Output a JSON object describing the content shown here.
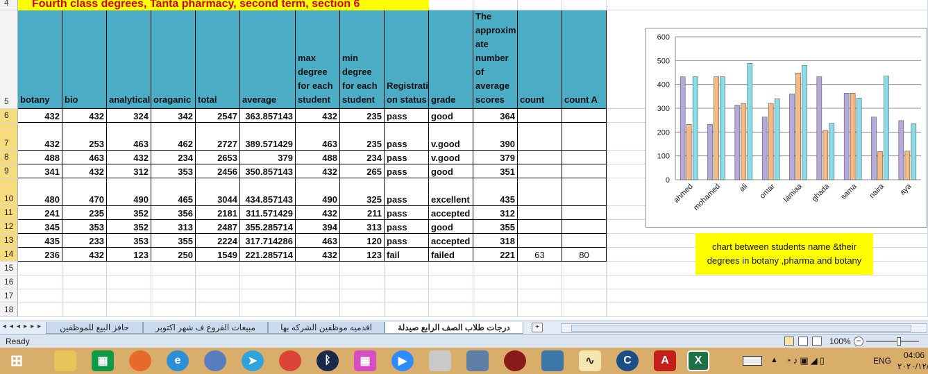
{
  "title": "Fourth class degrees, Tanta pharmacy, second term, section 6",
  "row_numbers": [
    "4",
    "5",
    "6",
    "7",
    "8",
    "9",
    "10",
    "11",
    "12",
    "13",
    "14",
    "15",
    "16",
    "17",
    "18"
  ],
  "headers": [
    "botany",
    "bio",
    "analytical",
    "oraganic",
    "total",
    "average",
    "max degree for each student",
    "min degree for each student",
    "Registrati on status",
    "grade",
    "The approxim ate number of average scores",
    "count",
    "count A"
  ],
  "rows": [
    [
      "432",
      "432",
      "324",
      "342",
      "2547",
      "363.857143",
      "432",
      "235",
      "pass",
      "good",
      "364"
    ],
    [
      "432",
      "253",
      "463",
      "462",
      "2727",
      "389.571429",
      "463",
      "235",
      "pass",
      "v.good",
      "390"
    ],
    [
      "488",
      "463",
      "432",
      "234",
      "2653",
      "379",
      "488",
      "234",
      "pass",
      "v.good",
      "379"
    ],
    [
      "341",
      "432",
      "312",
      "353",
      "2456",
      "350.857143",
      "432",
      "265",
      "pass",
      "good",
      "351"
    ],
    [
      "480",
      "470",
      "490",
      "465",
      "3044",
      "434.857143",
      "490",
      "325",
      "pass",
      "excellent",
      "435"
    ],
    [
      "241",
      "235",
      "352",
      "356",
      "2181",
      "311.571429",
      "432",
      "211",
      "pass",
      "accepted",
      "312"
    ],
    [
      "345",
      "353",
      "352",
      "313",
      "2487",
      "355.285714",
      "394",
      "313",
      "pass",
      "good",
      "355"
    ],
    [
      "435",
      "233",
      "353",
      "355",
      "2224",
      "317.714286",
      "463",
      "120",
      "pass",
      "accepted",
      "318"
    ],
    [
      "236",
      "432",
      "123",
      "250",
      "1549",
      "221.285714",
      "432",
      "123",
      "fail",
      "failed",
      "221"
    ]
  ],
  "count_value": "63",
  "count_a_value": "80",
  "note": {
    "line1": "chart between students name &their",
    "line2": "degrees in botany ,pharma and botany"
  },
  "tabs": [
    "درجات طلاب الصف الرابع صيدلة",
    "اقدميه موظفين الشركه بها",
    "مبيعات الفروع ف شهر اكتوبر",
    "حافز البيع للموظفين"
  ],
  "status": {
    "ready": "Ready",
    "zoom": "100%"
  },
  "taskbar": {
    "lang": "ENG",
    "time": "04:06",
    "date": "٢٠٢٠/١٢/"
  },
  "colors": {
    "header_fill": "#4bacc6",
    "title_fill": "#ffff00",
    "title_text": "#d40000",
    "series1": "#b6a7dd",
    "series2": "#f7b982",
    "series3": "#88dde9"
  },
  "chart_data": {
    "type": "bar",
    "categories": [
      "ahmed",
      "mohamed",
      "ali",
      "omar",
      "lamiaa",
      "ghada",
      "sama",
      "naira",
      "aya"
    ],
    "series": [
      {
        "values": [
          432,
          232,
          313,
          263,
          360,
          432,
          363,
          263,
          248
        ]
      },
      {
        "values": [
          232,
          432,
          320,
          320,
          448,
          207,
          363,
          118,
          120
        ]
      },
      {
        "values": [
          432,
          432,
          488,
          340,
          480,
          237,
          343,
          435,
          235
        ]
      }
    ],
    "ylim": [
      0,
      600
    ],
    "yticks": [
      "0",
      "100",
      "200",
      "300",
      "400",
      "500",
      "600"
    ],
    "grid": true,
    "legend": "none"
  }
}
